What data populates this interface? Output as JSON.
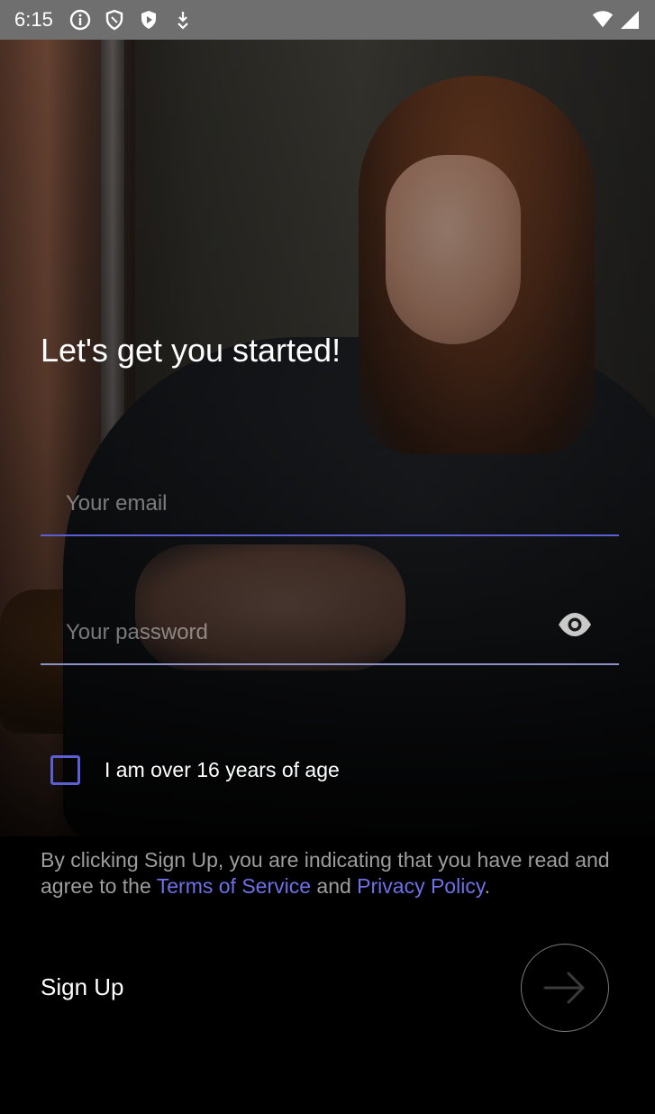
{
  "status_bar": {
    "time": "6:15",
    "left_icons": [
      "info-icon",
      "shield-icon",
      "play-shield-icon",
      "download-icon"
    ],
    "right_icons": [
      "wifi-icon",
      "signal-icon"
    ]
  },
  "title": "Let's get you started!",
  "email": {
    "placeholder": "Your email",
    "value": ""
  },
  "password": {
    "placeholder": "Your password",
    "value": ""
  },
  "age_checkbox": {
    "label": "I am over 16 years of age",
    "checked": false
  },
  "legal": {
    "prefix": "By clicking Sign Up, you are indicating that you have read and agree to the ",
    "terms_link": "Terms of Service",
    "middle": " and ",
    "privacy_link": "Privacy Policy",
    "suffix": "."
  },
  "signup": {
    "label": "Sign Up"
  },
  "colors": {
    "accent": "#5b5fd6",
    "link": "#6d70e6",
    "status_bar": "#6f6f6f",
    "muted_text": "#9d9d9d"
  }
}
